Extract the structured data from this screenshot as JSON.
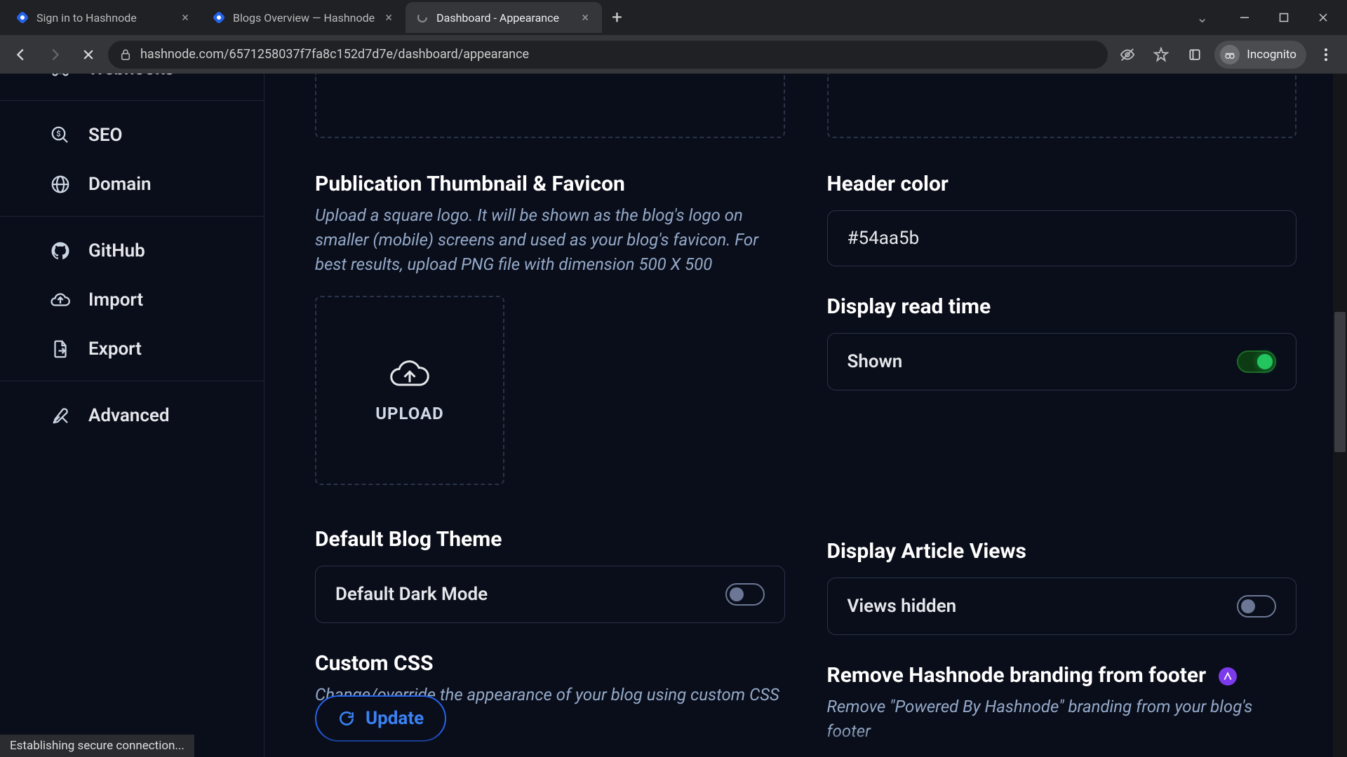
{
  "browser": {
    "tabs": [
      {
        "title": "Sign in to Hashnode"
      },
      {
        "title": "Blogs Overview — Hashnode"
      },
      {
        "title": "Dashboard - Appearance"
      }
    ],
    "url": "hashnode.com/6571258037f7fa8c152d7d7e/dashboard/appearance",
    "incognito_label": "Incognito",
    "status": "Establishing secure connection..."
  },
  "sidebar": {
    "items": [
      {
        "label": "Webhooks"
      },
      {
        "label": "SEO"
      },
      {
        "label": "Domain"
      },
      {
        "label": "GitHub"
      },
      {
        "label": "Import"
      },
      {
        "label": "Export"
      },
      {
        "label": "Advanced"
      }
    ]
  },
  "sections": {
    "thumbnail": {
      "title": "Publication Thumbnail & Favicon",
      "desc": "Upload a square logo. It will be shown as the blog's logo on smaller (mobile) screens and used as your blog's favicon. For best results, upload PNG file with dimension 500 X 500",
      "upload_label": "UPLOAD"
    },
    "header_color": {
      "title": "Header color",
      "value": "#54aa5b"
    },
    "read_time": {
      "title": "Display read time",
      "label": "Shown"
    },
    "default_theme": {
      "title": "Default Blog Theme",
      "label": "Default Dark Mode"
    },
    "article_views": {
      "title": "Display Article Views",
      "label": "Views hidden"
    },
    "custom_css": {
      "title": "Custom CSS",
      "desc": "Change/override the appearance of your blog using custom CSS"
    },
    "remove_branding": {
      "title": "Remove Hashnode branding from footer",
      "desc": "Remove \"Powered By Hashnode\" branding from your blog's footer"
    },
    "update_btn": "Update"
  }
}
